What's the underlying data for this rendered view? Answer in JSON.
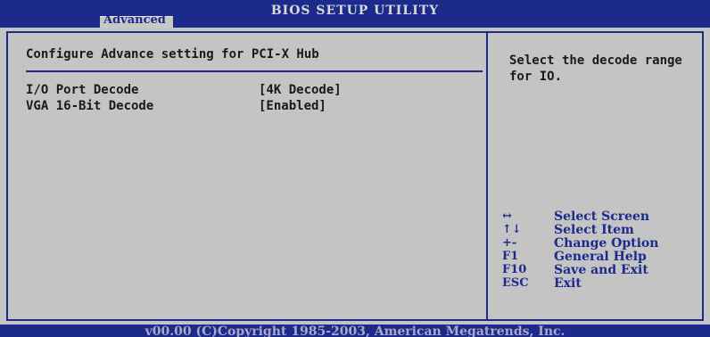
{
  "header": {
    "title": "BIOS SETUP UTILITY",
    "active_tab": "Advanced"
  },
  "main": {
    "section_title": "Configure Advance setting for PCI-X Hub",
    "settings": [
      {
        "label": "I/O Port Decode",
        "value": "[4K Decode]"
      },
      {
        "label": "VGA 16-Bit Decode",
        "value": "[Enabled]"
      }
    ]
  },
  "help": {
    "text": "Select the decode range for IO."
  },
  "keys": [
    {
      "key": "↔",
      "desc": "Select Screen"
    },
    {
      "key": "↑↓",
      "desc": "Select Item"
    },
    {
      "key": "+-",
      "desc": "Change Option"
    },
    {
      "key": "F1",
      "desc": "General Help"
    },
    {
      "key": "F10",
      "desc": "Save and Exit"
    },
    {
      "key": "ESC",
      "desc": "Exit"
    }
  ],
  "footer": {
    "text": "v00.00 (C)Copyright 1985-2003, American Megatrends, Inc."
  },
  "colors": {
    "bios_blue": "#1c2a8c",
    "panel_gray": "#c4c4c4",
    "text_dark": "#1a1a1a"
  }
}
